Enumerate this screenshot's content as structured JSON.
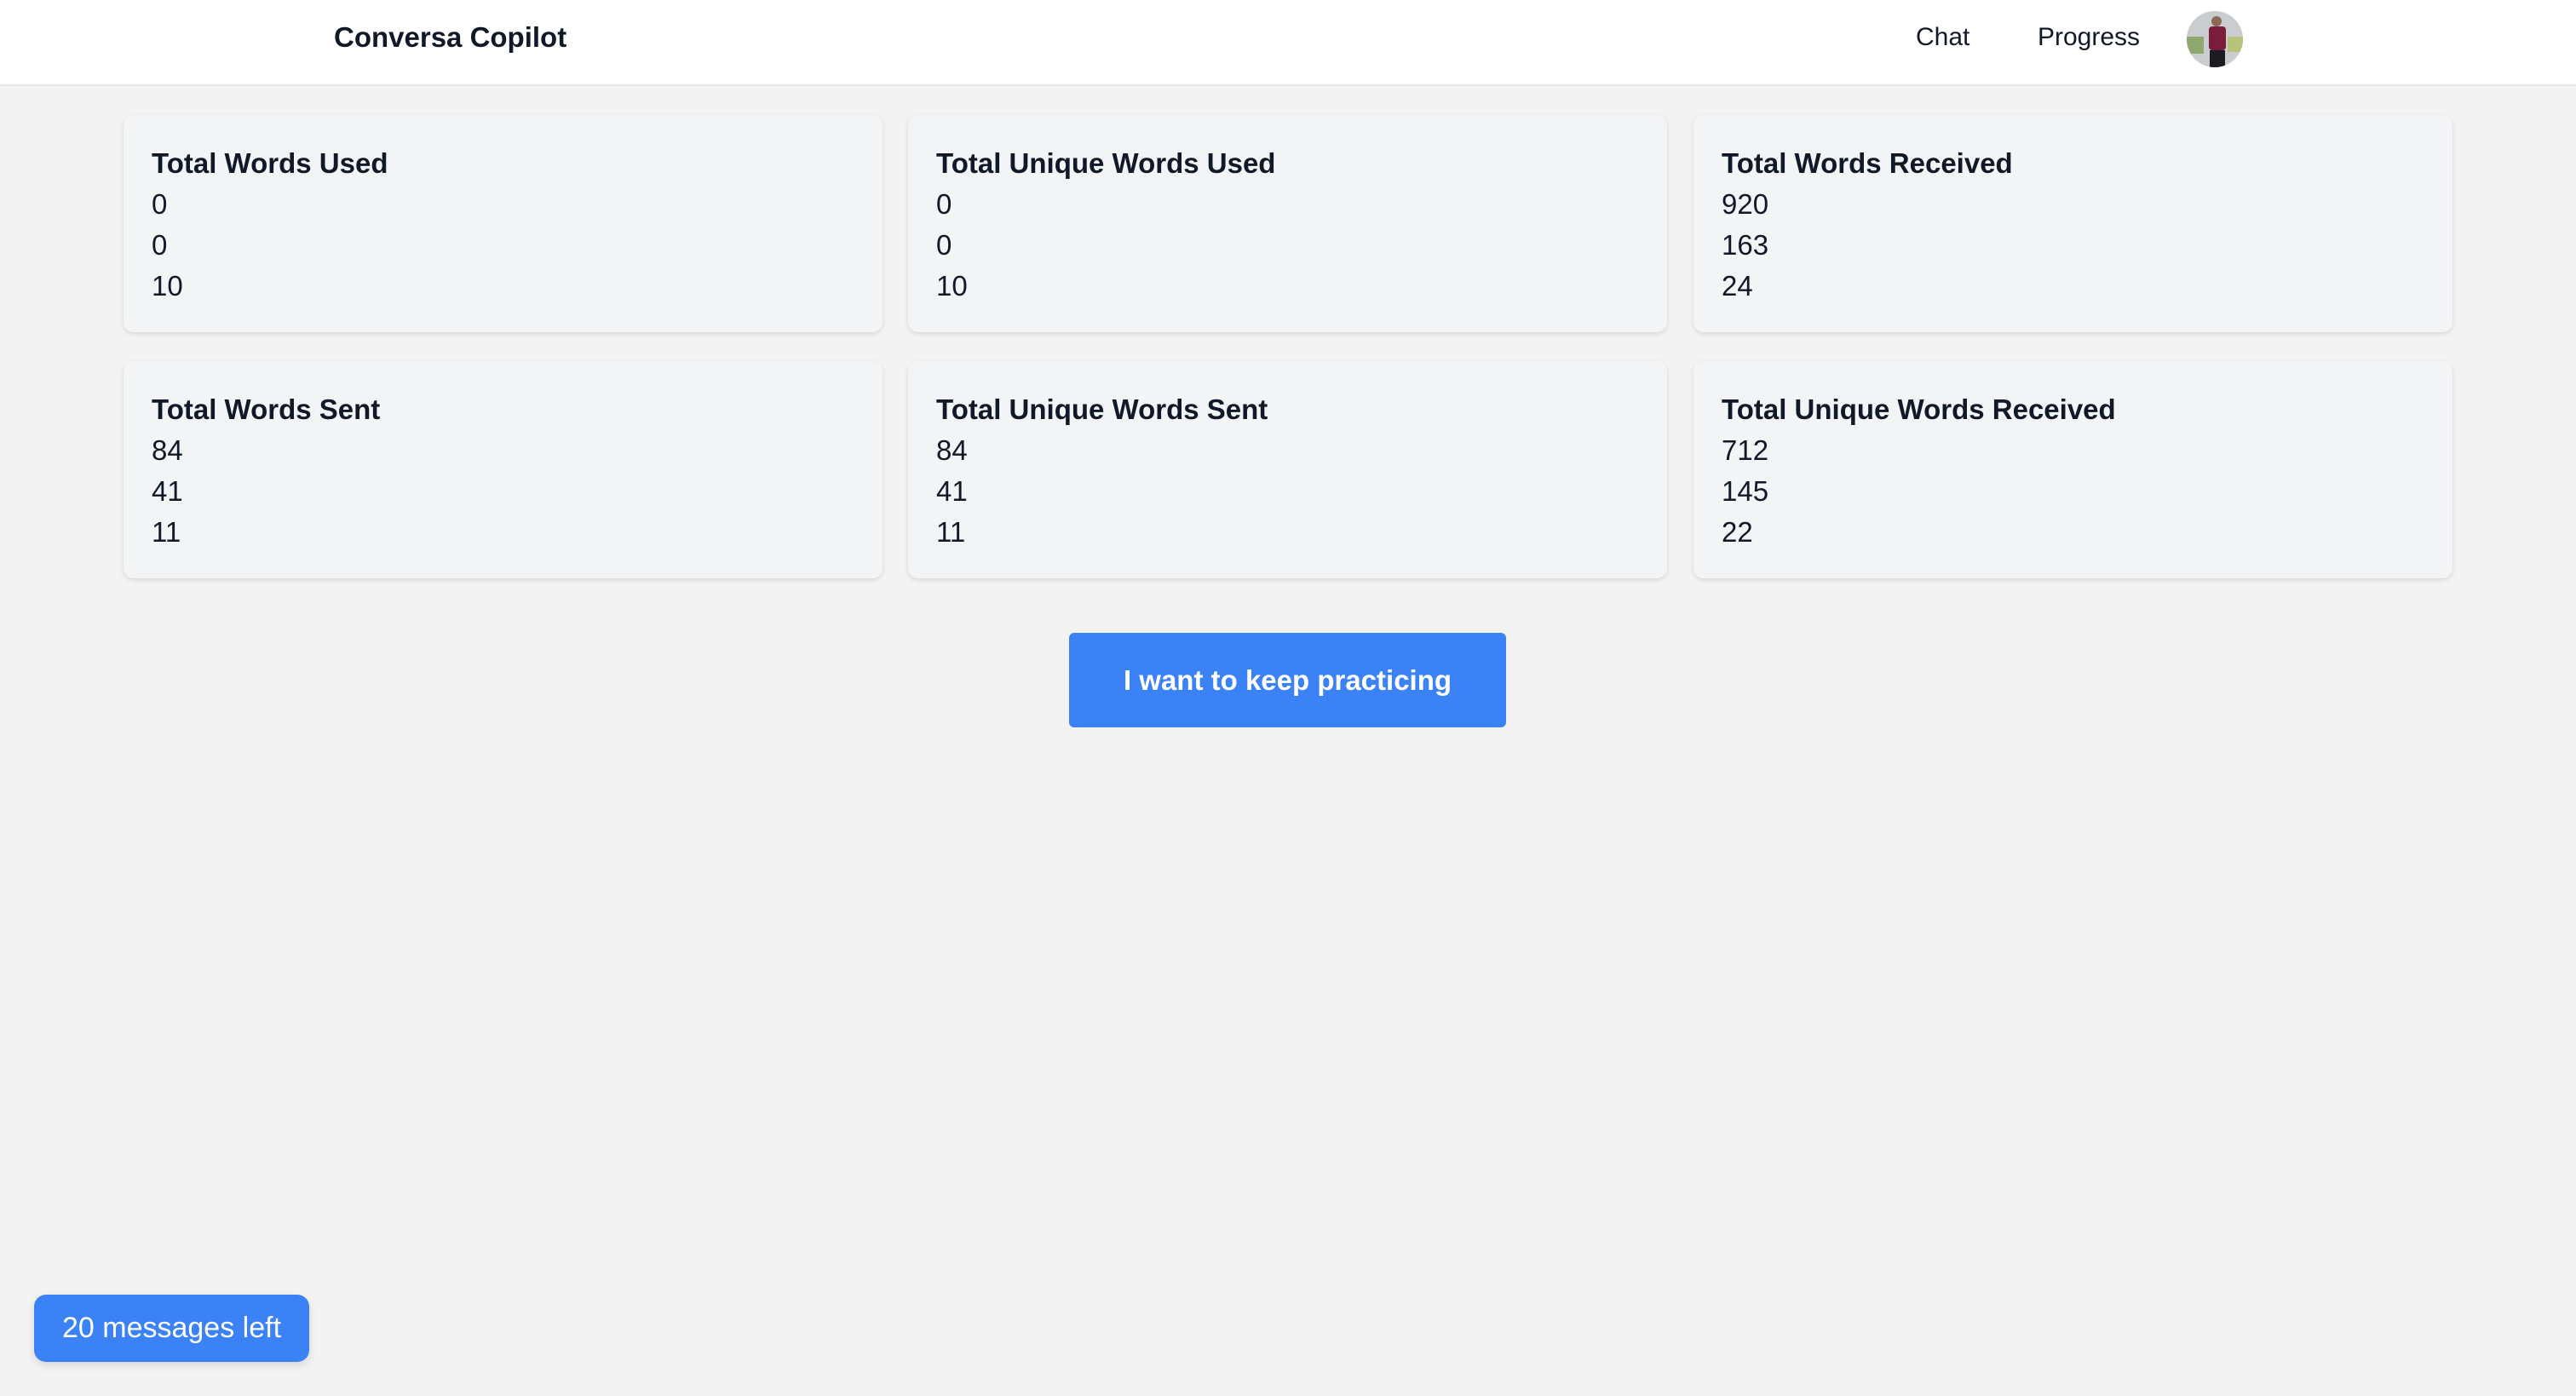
{
  "header": {
    "brand": "Conversa Copilot",
    "nav": [
      "Chat",
      "Progress"
    ],
    "avatar": "user-avatar"
  },
  "cards": [
    {
      "title": "Total Words Used",
      "values": [
        "0",
        "0",
        "10"
      ]
    },
    {
      "title": "Total Unique Words Used",
      "values": [
        "0",
        "0",
        "10"
      ]
    },
    {
      "title": "Total Words Received",
      "values": [
        "920",
        "163",
        "24"
      ]
    },
    {
      "title": "Total Words Sent",
      "values": [
        "84",
        "41",
        "11"
      ]
    },
    {
      "title": "Total Unique Words Sent",
      "values": [
        "84",
        "41",
        "11"
      ]
    },
    {
      "title": "Total Unique Words Received",
      "values": [
        "712",
        "145",
        "22"
      ]
    }
  ],
  "cta_label": "I want to keep practicing",
  "messages_left": "20 messages left",
  "colors": {
    "accent": "#3b82f6"
  }
}
